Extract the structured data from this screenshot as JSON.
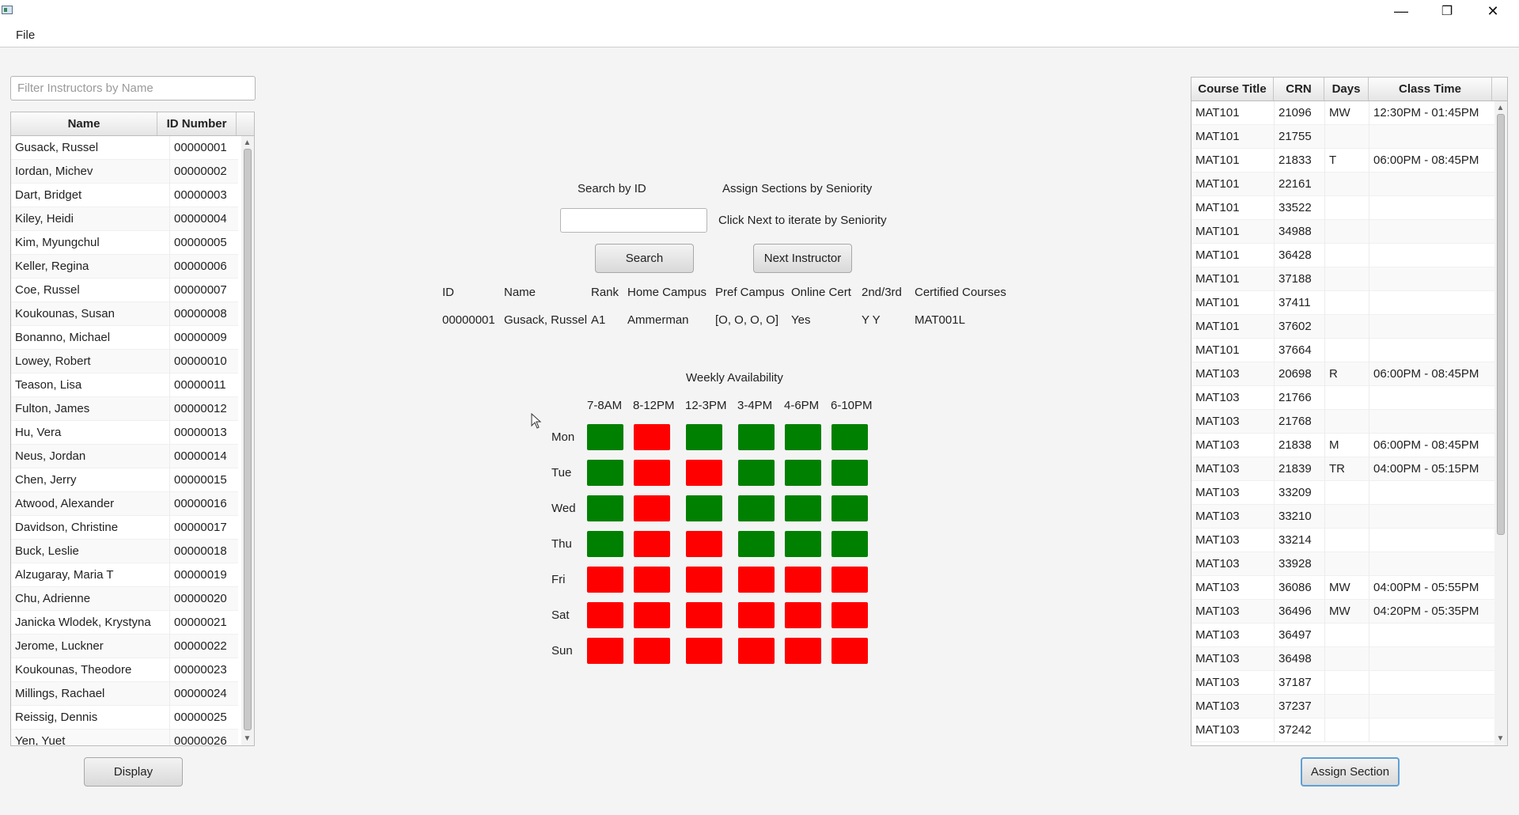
{
  "window": {
    "minimize": "—",
    "maximize": "❐",
    "close": "✕"
  },
  "menu": {
    "file": "File"
  },
  "instructors": {
    "filter_placeholder": "Filter Instructors by Name",
    "columns": [
      "Name",
      "ID Number"
    ],
    "rows": [
      [
        "Gusack, Russel",
        "00000001"
      ],
      [
        "Iordan, Michev",
        "00000002"
      ],
      [
        "Dart, Bridget",
        "00000003"
      ],
      [
        "Kiley, Heidi",
        "00000004"
      ],
      [
        "Kim, Myungchul",
        "00000005"
      ],
      [
        "Keller, Regina",
        "00000006"
      ],
      [
        "Coe, Russel",
        "00000007"
      ],
      [
        "Koukounas, Susan",
        "00000008"
      ],
      [
        "Bonanno, Michael",
        "00000009"
      ],
      [
        "Lowey, Robert",
        "00000010"
      ],
      [
        "Teason, Lisa",
        "00000011"
      ],
      [
        "Fulton, James",
        "00000012"
      ],
      [
        "Hu, Vera",
        "00000013"
      ],
      [
        "Neus, Jordan",
        "00000014"
      ],
      [
        "Chen, Jerry",
        "00000015"
      ],
      [
        "Atwood, Alexander",
        "00000016"
      ],
      [
        "Davidson, Christine",
        "00000017"
      ],
      [
        "Buck, Leslie",
        "00000018"
      ],
      [
        "Alzugaray, Maria T",
        "00000019"
      ],
      [
        "Chu, Adrienne",
        "00000020"
      ],
      [
        "Janicka Wlodek, Krystyna",
        "00000021"
      ],
      [
        "Jerome, Luckner",
        "00000022"
      ],
      [
        "Koukounas, Theodore",
        "00000023"
      ],
      [
        "Millings, Rachael",
        "00000024"
      ],
      [
        "Reissig, Dennis",
        "00000025"
      ],
      [
        "Yen, Yuet",
        "00000026"
      ]
    ],
    "display_button": "Display"
  },
  "search": {
    "search_by_id_label": "Search by ID",
    "id_value": "",
    "search_button": "Search",
    "seniority_label": "Assign Sections by Seniority",
    "iterate_hint": "Click Next to iterate by Seniority",
    "next_button": "Next Instructor"
  },
  "details": {
    "headers": {
      "id": "ID",
      "name": "Name",
      "rank": "Rank",
      "home_campus": "Home Campus",
      "pref_campus": "Pref Campus",
      "online_cert": "Online Cert",
      "second_third": "2nd/3rd",
      "certified_courses": "Certified Courses"
    },
    "values": {
      "id": "00000001",
      "name": "Gusack, Russel",
      "rank": "A1",
      "home_campus": "Ammerman",
      "pref_campus": "[O, O, O, O]",
      "online_cert": "Yes",
      "second_third": "Y Y",
      "certified_courses": "MAT001L"
    }
  },
  "availability": {
    "title": "Weekly Availability",
    "time_slots": [
      "7-8AM",
      "8-12PM",
      "12-3PM",
      "3-4PM",
      "4-6PM",
      "6-10PM"
    ],
    "days": [
      "Mon",
      "Tue",
      "Wed",
      "Thu",
      "Fri",
      "Sat",
      "Sun"
    ],
    "grid": [
      [
        1,
        0,
        1,
        1,
        1,
        1
      ],
      [
        1,
        0,
        0,
        1,
        1,
        1
      ],
      [
        1,
        0,
        1,
        1,
        1,
        1
      ],
      [
        1,
        0,
        0,
        1,
        1,
        1
      ],
      [
        0,
        0,
        0,
        0,
        0,
        0
      ],
      [
        0,
        0,
        0,
        0,
        0,
        0
      ],
      [
        0,
        0,
        0,
        0,
        0,
        0
      ]
    ],
    "colors": {
      "available": "#008000",
      "unavailable": "#ff0000"
    }
  },
  "courses": {
    "columns": [
      "Course Title",
      "CRN",
      "Days",
      "Class Time"
    ],
    "rows": [
      [
        "MAT101",
        "21096",
        "MW",
        "12:30PM - 01:45PM"
      ],
      [
        "MAT101",
        "21755",
        "",
        ""
      ],
      [
        "MAT101",
        "21833",
        "T",
        "06:00PM - 08:45PM"
      ],
      [
        "MAT101",
        "22161",
        "",
        ""
      ],
      [
        "MAT101",
        "33522",
        "",
        ""
      ],
      [
        "MAT101",
        "34988",
        "",
        ""
      ],
      [
        "MAT101",
        "36428",
        "",
        ""
      ],
      [
        "MAT101",
        "37188",
        "",
        ""
      ],
      [
        "MAT101",
        "37411",
        "",
        ""
      ],
      [
        "MAT101",
        "37602",
        "",
        ""
      ],
      [
        "MAT101",
        "37664",
        "",
        ""
      ],
      [
        "MAT103",
        "20698",
        "R",
        "06:00PM - 08:45PM"
      ],
      [
        "MAT103",
        "21766",
        "",
        ""
      ],
      [
        "MAT103",
        "21768",
        "",
        ""
      ],
      [
        "MAT103",
        "21838",
        "M",
        "06:00PM - 08:45PM"
      ],
      [
        "MAT103",
        "21839",
        "TR",
        "04:00PM - 05:15PM"
      ],
      [
        "MAT103",
        "33209",
        "",
        ""
      ],
      [
        "MAT103",
        "33210",
        "",
        ""
      ],
      [
        "MAT103",
        "33214",
        "",
        ""
      ],
      [
        "MAT103",
        "33928",
        "",
        ""
      ],
      [
        "MAT103",
        "36086",
        "MW",
        "04:00PM - 05:55PM"
      ],
      [
        "MAT103",
        "36496",
        "MW",
        "04:20PM - 05:35PM"
      ],
      [
        "MAT103",
        "36497",
        "",
        ""
      ],
      [
        "MAT103",
        "36498",
        "",
        ""
      ],
      [
        "MAT103",
        "37187",
        "",
        ""
      ],
      [
        "MAT103",
        "37237",
        "",
        ""
      ],
      [
        "MAT103",
        "37242",
        "",
        ""
      ]
    ],
    "assign_button": "Assign Section"
  }
}
